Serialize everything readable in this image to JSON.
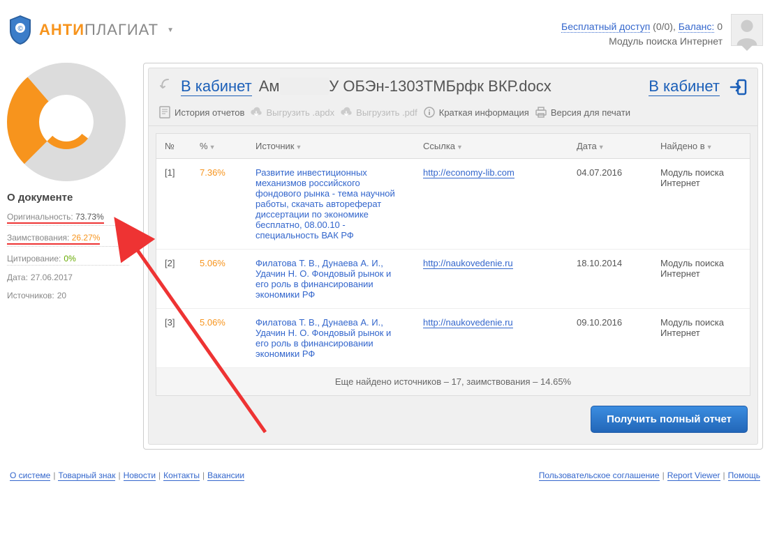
{
  "header": {
    "logo_anti": "АНТИ",
    "logo_plag": "ПЛАГИАТ",
    "free_access": "Бесплатный доступ",
    "free_access_count": "(0/0),",
    "balance_label": "Баланс:",
    "balance_value": "0",
    "module": "Модуль поиска Интернет"
  },
  "titlebar": {
    "back_cabinet": "В кабинет",
    "doc_prefix": "Ам",
    "doc_suffix": "У ОБЭн-1303ТМБрфк ВКР.docx",
    "right_cabinet": "В кабинет"
  },
  "toolbar": {
    "history": "История отчетов",
    "export_apdx": "Выгрузить .apdx",
    "export_pdf": "Выгрузить .pdf",
    "brief": "Краткая информация",
    "print": "Версия для печати"
  },
  "sidebar": {
    "title": "О документе",
    "originality_label": "Оригинальность:",
    "originality_value": "73.73%",
    "plagiarism_label": "Заимствования:",
    "plagiarism_value": "26.27%",
    "citation_label": "Цитирование:",
    "citation_value": "0%",
    "date_label": "Дата:",
    "date_value": "27.06.2017",
    "sources_label": "Источников:",
    "sources_value": "20"
  },
  "table": {
    "headers": {
      "num": "№",
      "pct": "%",
      "src": "Источник",
      "link": "Ссылка",
      "date": "Дата",
      "found": "Найдено в"
    },
    "rows": [
      {
        "num": "[1]",
        "pct": "7.36%",
        "src": "Развитие инвестиционных механизмов российского фондового рынка - тема научной работы, скачать автореферат диссертации по экономике бесплатно, 08.00.10 - специальность ВАК РФ",
        "link": "http://economy-lib.com",
        "date": "04.07.2016",
        "found": "Модуль поиска Интернет"
      },
      {
        "num": "[2]",
        "pct": "5.06%",
        "src": "Филатова Т. В., Дунаева А. И., Удачин Н. О. Фондовый рынок и его роль в финансировании экономики РФ",
        "link": "http://naukovedenie.ru",
        "date": "18.10.2014",
        "found": "Модуль поиска Интернет"
      },
      {
        "num": "[3]",
        "pct": "5.06%",
        "src": "Филатова Т. В., Дунаева А. И., Удачин Н. О. Фондовый рынок и его роль в финансировании экономики РФ",
        "link": "http://naukovedenie.ru",
        "date": "09.10.2016",
        "found": "Модуль поиска Интернет"
      }
    ],
    "more": "Еще найдено источников – 17, заимствования – 14.65%"
  },
  "actions": {
    "full_report": "Получить полный отчет"
  },
  "footer": {
    "left": [
      "О системе",
      "Товарный знак",
      "Новости",
      "Контакты",
      "Вакансии"
    ],
    "right": [
      "Пользовательское соглашение",
      "Report Viewer",
      "Помощь"
    ]
  },
  "chart_data": {
    "type": "pie",
    "title": "О документе",
    "series": [
      {
        "name": "Оригинальность",
        "value": 73.73,
        "color": "#dcdcdc"
      },
      {
        "name": "Заимствования",
        "value": 26.27,
        "color": "#f7941d"
      },
      {
        "name": "Цитирование",
        "value": 0,
        "color": "#66aa00"
      }
    ]
  }
}
